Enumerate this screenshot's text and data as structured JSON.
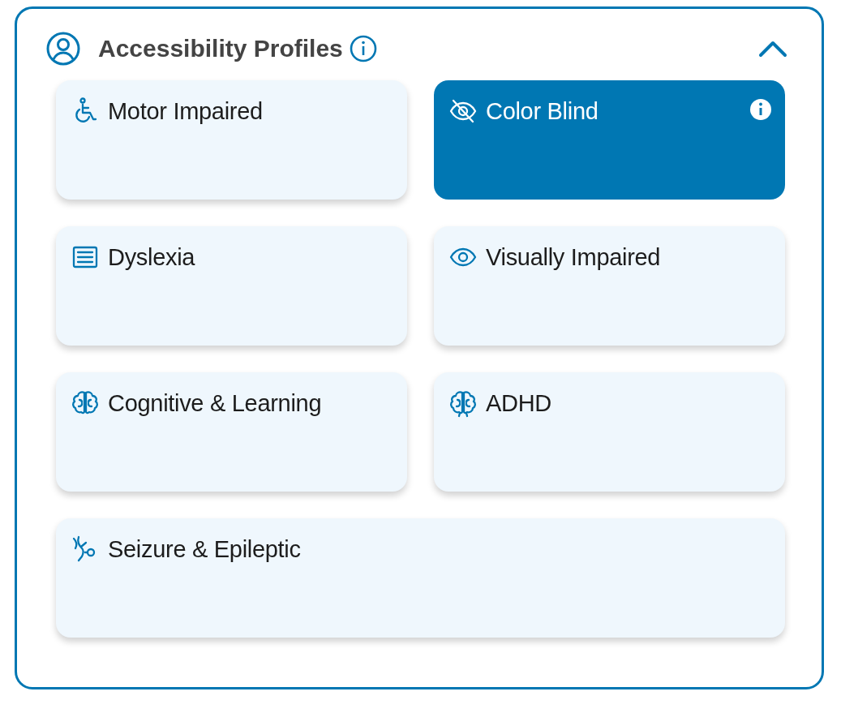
{
  "panel": {
    "title": "Accessibility Profiles",
    "expanded": true
  },
  "profiles": [
    {
      "label": "Motor Impaired",
      "selected": false
    },
    {
      "label": "Color Blind",
      "selected": true
    },
    {
      "label": "Dyslexia",
      "selected": false
    },
    {
      "label": "Visually Impaired",
      "selected": false
    },
    {
      "label": "Cognitive & Learning",
      "selected": false
    },
    {
      "label": "ADHD",
      "selected": false
    },
    {
      "label": "Seizure & Epileptic",
      "selected": false
    }
  ]
}
